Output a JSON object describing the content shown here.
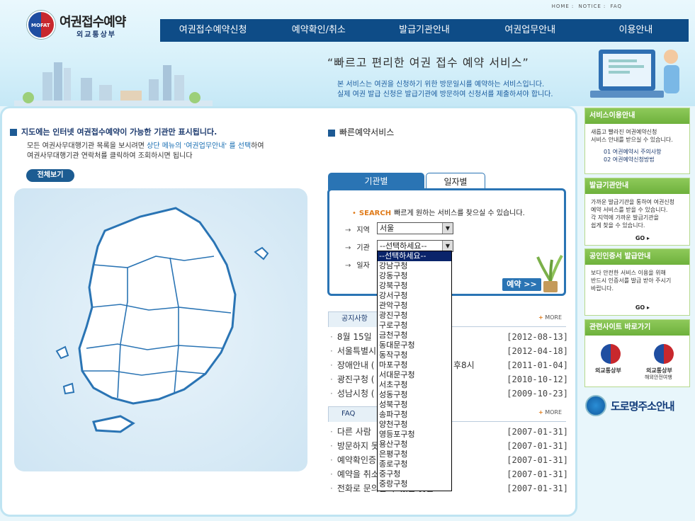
{
  "logo": {
    "title": "여권접수예약",
    "sub": "외교통상부",
    "seal_text": "MOFAT"
  },
  "topnav": [
    "HOME",
    "NOTICE",
    "FAQ"
  ],
  "mainnav": [
    "여권접수예약신청",
    "예약확인/취소",
    "발급기관안내",
    "여권업무안내",
    "이용안내"
  ],
  "banner": {
    "slogan": "“빠르고 편리한 여권 접수 예약 서비스”",
    "sub1": "본 서비스는 여권을 신청하기 위한 방문일시를 예약하는 서비스입니다.",
    "sub2": "실제 여권 발급 신청은 발급기관에 방문하여 신청서를 제출하셔야 합니다."
  },
  "map": {
    "heading": "지도에는 인터넷 여권접수예약이 가능한 기관만 표시됩니다.",
    "desc1_a": "모든 여권사무대행기관 목록을 보시려면 ",
    "desc1_hl": "상단 메뉴의 '여권업무안내' 를 선택",
    "desc1_b": "하여",
    "desc2": "여권사무대행기관 연락처를 클릭하여 조회하시면 됩니다",
    "fullview": "전체보기"
  },
  "quick": {
    "heading": "빠른예약서비스",
    "tab_org": "기관별",
    "tab_date": "일자별",
    "search_label": "SEARCH",
    "search_desc": "빠르게 원하는 서비스를 찾으실 수 있습니다.",
    "region_label": "지역",
    "region_value": "서울",
    "org_label": "기관",
    "org_value": "--선택하세요--",
    "date_label": "일자",
    "reserve": "예약 >>"
  },
  "dropdown": [
    "--선택하세요--",
    "강남구청",
    "강동구청",
    "강북구청",
    "강서구청",
    "관악구청",
    "광진구청",
    "구로구청",
    "금천구청",
    "동대문구청",
    "동작구청",
    "마포구청",
    "서대문구청",
    "서초구청",
    "성동구청",
    "성북구청",
    "송파구청",
    "양천구청",
    "영등포구청",
    "용산구청",
    "은평구청",
    "종로구청",
    "중구청",
    "중랑구청"
  ],
  "notice": {
    "title": "공지사항",
    "more": "MORE",
    "items": [
      {
        "text": "8월 15일",
        "tail": "가",
        "date": "[2012-08-13]"
      },
      {
        "text": "서울특별시",
        "tail": "",
        "date": "[2012-04-18]"
      },
      {
        "text": "장애안내 (",
        "tail": "후8시",
        "date": "[2011-01-04]"
      },
      {
        "text": "광진구청 (",
        "tail": "",
        "date": "[2010-10-12]"
      },
      {
        "text": "성남시청 (",
        "tail": "",
        "date": "[2009-10-23]"
      }
    ]
  },
  "faq": {
    "title": "FAQ",
    "more": "MORE",
    "items": [
      {
        "text": "다른 사람",
        "date": "[2007-01-31]"
      },
      {
        "text": "방문하지 못",
        "date": "[2007-01-31]"
      },
      {
        "text": "예약확인증",
        "date": "[2007-01-31]"
      },
      {
        "text": "예약을 취소",
        "date": "[2007-01-31]"
      },
      {
        "text": "전화로 문의할 수 있는 곳은?",
        "date": "[2007-01-31]"
      }
    ]
  },
  "sidebar": {
    "svc": {
      "title": "서비스이용안내",
      "l1": "새롭고 빨라진 여권예약신청",
      "l2": "서비스 안내를 받으실 수 있습니다.",
      "i1": "01 여권예약시 주의사항",
      "i2": "02 여권예약신청방법"
    },
    "issue": {
      "title": "발급기관안내",
      "l1": "가까운 발급기관을 통하여 여권신청",
      "l2": "예약 서비스를 받을 수 있습니다.",
      "l3": "각 지역에 가까운 발급기관을",
      "l4": "쉽게 찾을 수 있습니다.",
      "go": "GO"
    },
    "cert": {
      "title": "공인인증서 발급안내",
      "l1": "보다 안전한 서비스 이용을 위해",
      "l2": "반드시 인증서를 발급 받아 주시기",
      "l3": "바랍니다.",
      "go": "GO"
    },
    "links": {
      "title": "관련사이트 바로가기",
      "a": "외교통상부",
      "b": "외교통상부",
      "b2": "해외안전여행"
    },
    "road": "도로명주소안내"
  },
  "colors": {
    "nav": "#0e4c87",
    "tab": "#2a74b4",
    "side": "#6eb13c",
    "accent": "#e07b1a"
  }
}
